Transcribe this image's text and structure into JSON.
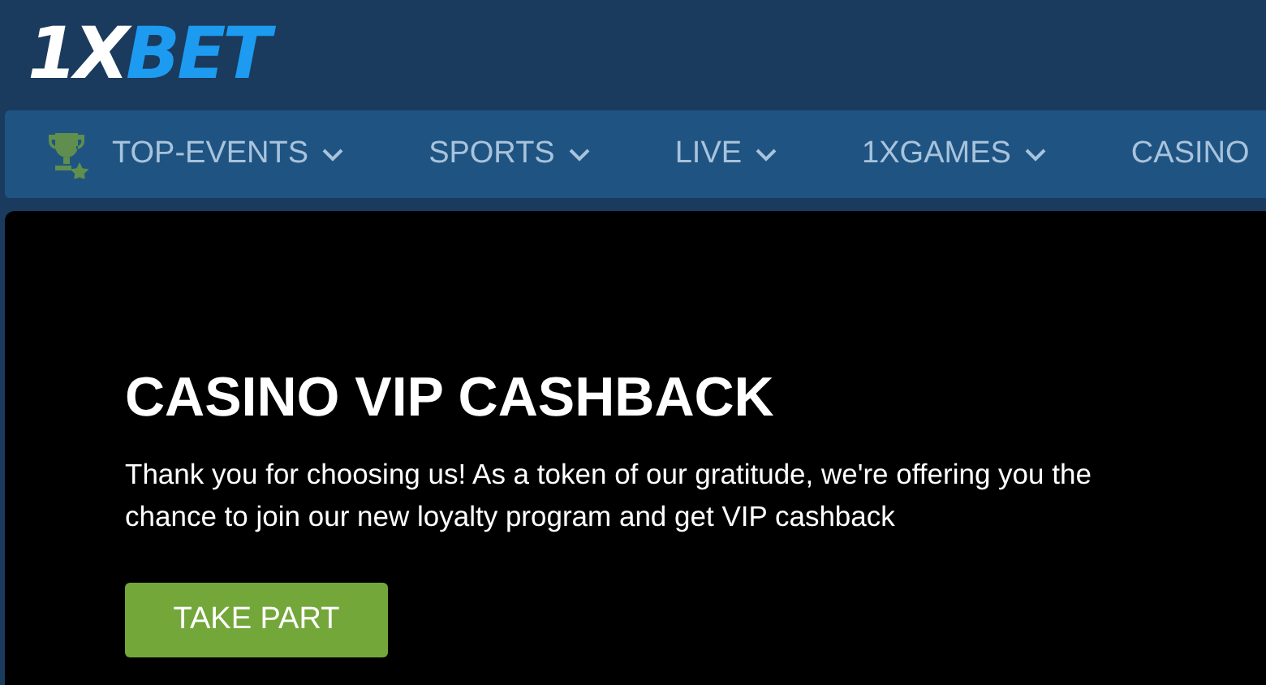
{
  "logo": {
    "prefix": "1X",
    "suffix": "BET"
  },
  "nav": [
    {
      "label": "TOP-EVENTS",
      "has_icon": true,
      "dropdown": true
    },
    {
      "label": "SPORTS",
      "has_icon": false,
      "dropdown": true
    },
    {
      "label": "LIVE",
      "has_icon": false,
      "dropdown": true
    },
    {
      "label": "1XGAMES",
      "has_icon": false,
      "dropdown": true
    },
    {
      "label": "CASINO",
      "has_icon": false,
      "dropdown": false
    }
  ],
  "promo": {
    "title": "CASINO VIP CASHBACK",
    "text": "Thank you for choosing us! As a token of our gratitude, we're offering you the chance to join our new loyalty program and get VIP cashback",
    "button": "TAKE PART"
  }
}
